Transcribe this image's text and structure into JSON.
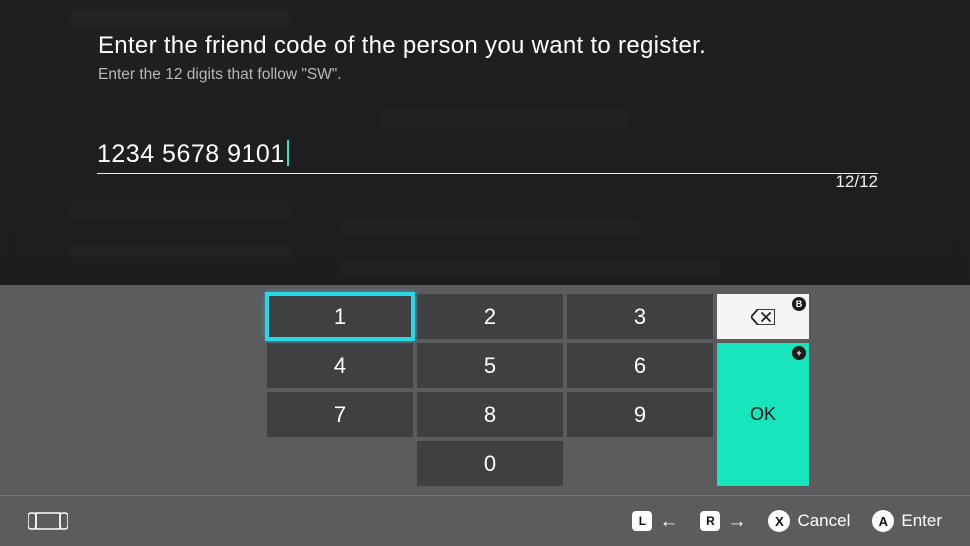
{
  "header": {
    "title": "Enter the friend code of the person you want to register.",
    "subtitle": "Enter the 12 digits that follow \"SW\"."
  },
  "input": {
    "value": "1234 5678 9101",
    "counter": "12/12"
  },
  "keypad": {
    "keys": [
      "1",
      "2",
      "3",
      "4",
      "5",
      "6",
      "7",
      "8",
      "9",
      "0"
    ],
    "selected": "1",
    "ok_label": "OK",
    "backspace_badge": "B",
    "ok_badge": "+"
  },
  "bottombar": {
    "l_label": "L",
    "r_label": "R",
    "cancel_key": "X",
    "cancel_label": "Cancel",
    "enter_key": "A",
    "enter_label": "Enter"
  }
}
